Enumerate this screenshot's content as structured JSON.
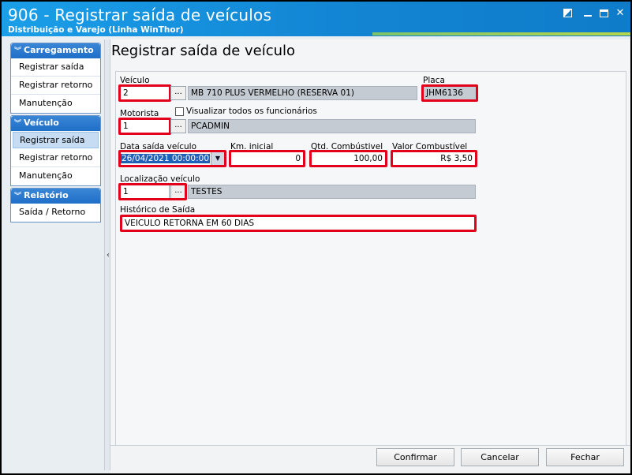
{
  "window": {
    "title": "906 - Registrar saída de veículos",
    "subtitle": "Distribuição e Varejo (Linha WinThor)"
  },
  "sidebar": {
    "groups": [
      {
        "title": "Carregamento",
        "items": [
          "Registrar saída",
          "Registrar retorno",
          "Manutenção"
        ]
      },
      {
        "title": "Veículo",
        "items": [
          "Registrar saída",
          "Registrar retorno",
          "Manutenção"
        ],
        "selected": 0
      },
      {
        "title": "Relatório",
        "items": [
          "Saída / Retorno"
        ]
      }
    ]
  },
  "form": {
    "page_title": "Registrar saída de veículo",
    "veiculo": {
      "label": "Veículo",
      "code": "2",
      "description": "MB 710 PLUS VERMELHO (RESERVA 01)"
    },
    "placa": {
      "label": "Placa",
      "value": "JHM6136"
    },
    "motorista": {
      "label": "Motorista",
      "code": "1",
      "name": "PCADMIN",
      "checkbox_label": "Visualizar todos os funcionários"
    },
    "data_saida": {
      "label": "Data saída veículo",
      "value": "26/04/2021 00:00:00"
    },
    "km_inicial": {
      "label": "Km. inicial",
      "value": "0"
    },
    "qtd_combustivel": {
      "label": "Qtd. Combústivel",
      "value": "100,00"
    },
    "valor_combustivel": {
      "label": "Valor Combustível",
      "value": "R$ 3,50"
    },
    "localizacao": {
      "label": "Localização veículo",
      "code": "1",
      "description": "TESTES"
    },
    "historico": {
      "label": "Histórico de Saída",
      "value": "VEICULO RETORNA EM 60 DIAS"
    }
  },
  "buttons": {
    "lookup": "...",
    "confirmar": "Confirmar",
    "cancelar": "Cancelar",
    "fechar": "Fechar"
  }
}
